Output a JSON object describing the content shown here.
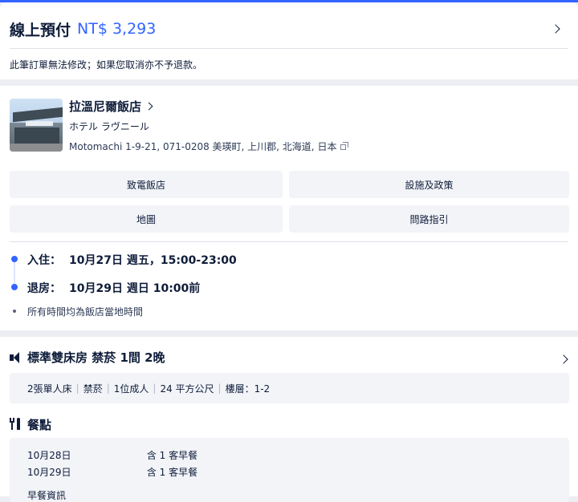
{
  "payment": {
    "label": "線上預付",
    "amount": "NT$ 3,293",
    "policy": "此筆訂單無法修改；如果您取消亦不予退款。"
  },
  "hotel": {
    "name": "拉溫尼爾飯店",
    "alt_name": "ホテル ラヴニール",
    "address": "Motomachi 1-9-21, 071-0208 美瑛町, 上川郡, 北海道, 日本",
    "buttons": {
      "call": "致電飯店",
      "policy": "設施及政策",
      "map": "地圖",
      "directions": "問路指引"
    }
  },
  "stay": {
    "check_in_label": "入住：",
    "check_in_value": "10月27日 週五，15:00-23:00",
    "check_out_label": "退房：",
    "check_out_value": "10月29日 週日 10:00前",
    "timezone_note": "所有時間均為飯店當地時間"
  },
  "room": {
    "title": "標準雙床房 禁菸  1間 2晚",
    "details": [
      "2張單人床",
      "禁菸",
      "1位成人",
      "24 平方公尺",
      "樓層：1-2"
    ]
  },
  "meals": {
    "title": "餐點",
    "rows": [
      {
        "date": "10月28日",
        "desc": "含 1 客早餐"
      },
      {
        "date": "10月29日",
        "desc": "含 1 客早餐"
      }
    ],
    "info_label": "早餐資訊"
  },
  "colors": {
    "accent": "#3264ff",
    "text": "#0f1d3a",
    "panel": "#f2f4f8",
    "background": "#eceef3"
  },
  "icons": [
    "chevron-right-icon",
    "copy-icon",
    "bed-icon",
    "meal-icon"
  ]
}
